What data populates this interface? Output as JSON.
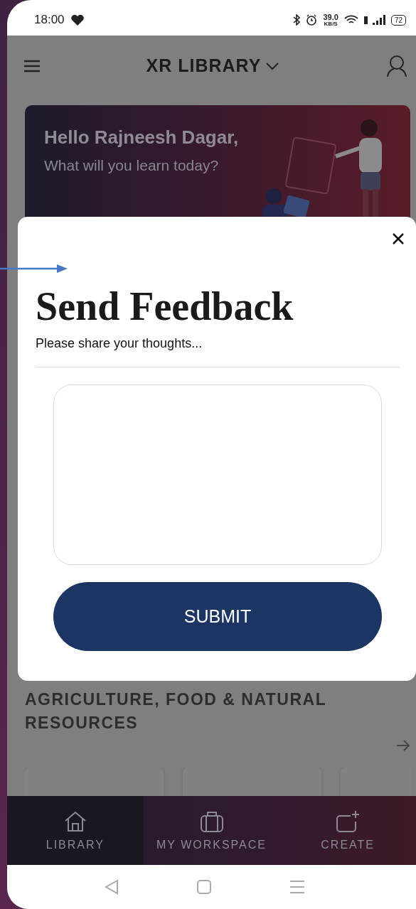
{
  "status_bar": {
    "time": "18:00",
    "speed": "39.0",
    "speed_unit": "KB/S",
    "battery": "72"
  },
  "header": {
    "title": "XR LIBRARY"
  },
  "banner": {
    "greeting": "Hello Rajneesh Dagar,",
    "prompt": "What will you learn today?"
  },
  "section": {
    "title": "AGRICULTURE, FOOD & NATURAL RESOURCES"
  },
  "bottom_nav": [
    {
      "label": "LIBRARY",
      "kind": "home",
      "selected": true
    },
    {
      "label": "MY WORKSPACE",
      "kind": "briefcase",
      "selected": false
    },
    {
      "label": "CREATE",
      "kind": "create",
      "selected": false
    }
  ],
  "dialog": {
    "title": "Send Feedback",
    "subtitle": "Please share your thoughts...",
    "button": "SUBMIT"
  }
}
